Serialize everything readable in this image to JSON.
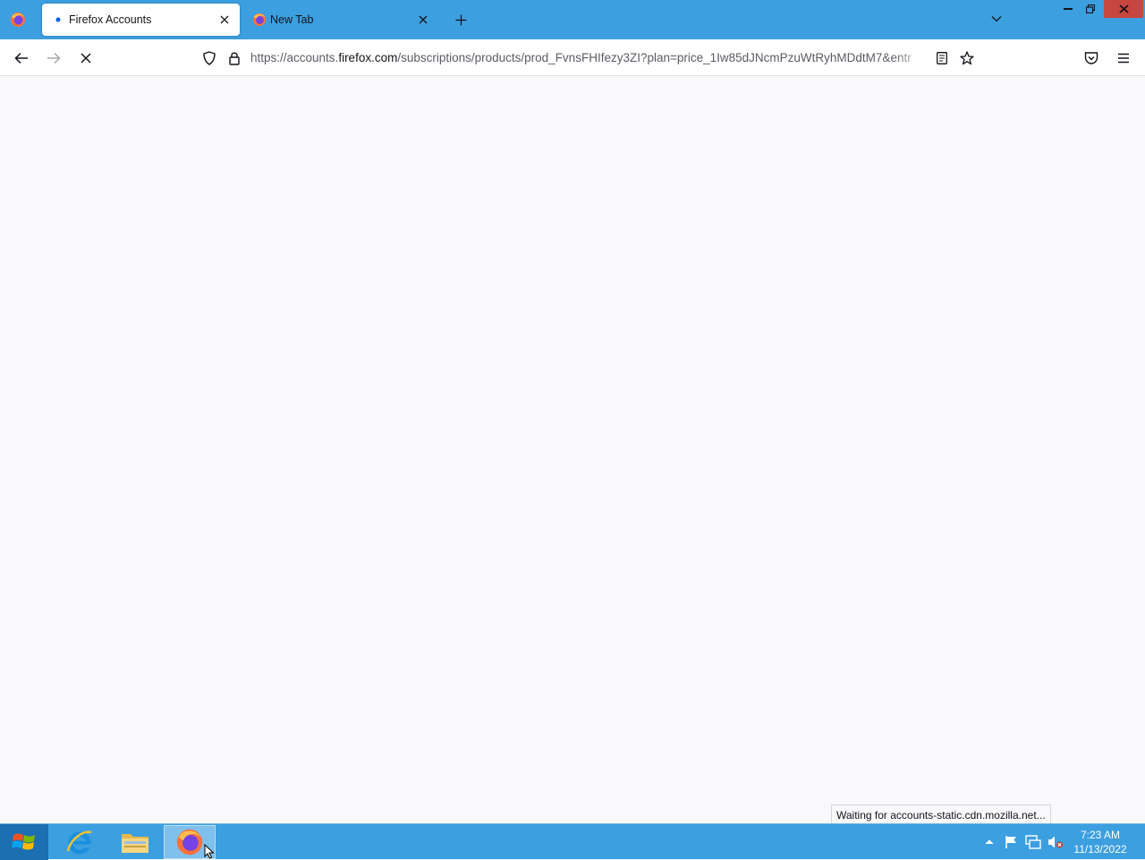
{
  "browser": {
    "tabs": [
      {
        "label": "Firefox Accounts",
        "active": true
      },
      {
        "label": "New Tab",
        "active": false
      }
    ],
    "url": {
      "prefix": "https://accounts.",
      "host": "firefox.com",
      "path": "/subscriptions/products/prod_FvnsFHIfezy3ZI?plan=price_1Iw85dJNcmPzuWtRyhMDdtM7&entr"
    },
    "status_text": "Waiting for accounts-static.cdn.mozilla.net..."
  },
  "taskbar": {
    "apps": [
      "internet-explorer",
      "file-explorer",
      "firefox"
    ],
    "clock": {
      "time": "7:23 AM",
      "date": "11/13/2022"
    }
  },
  "colors": {
    "titlebar": "#3c9fe0",
    "taskbar": "#3c9fe0",
    "close_button": "#c7463f",
    "content_bg": "#f9f9fb"
  }
}
